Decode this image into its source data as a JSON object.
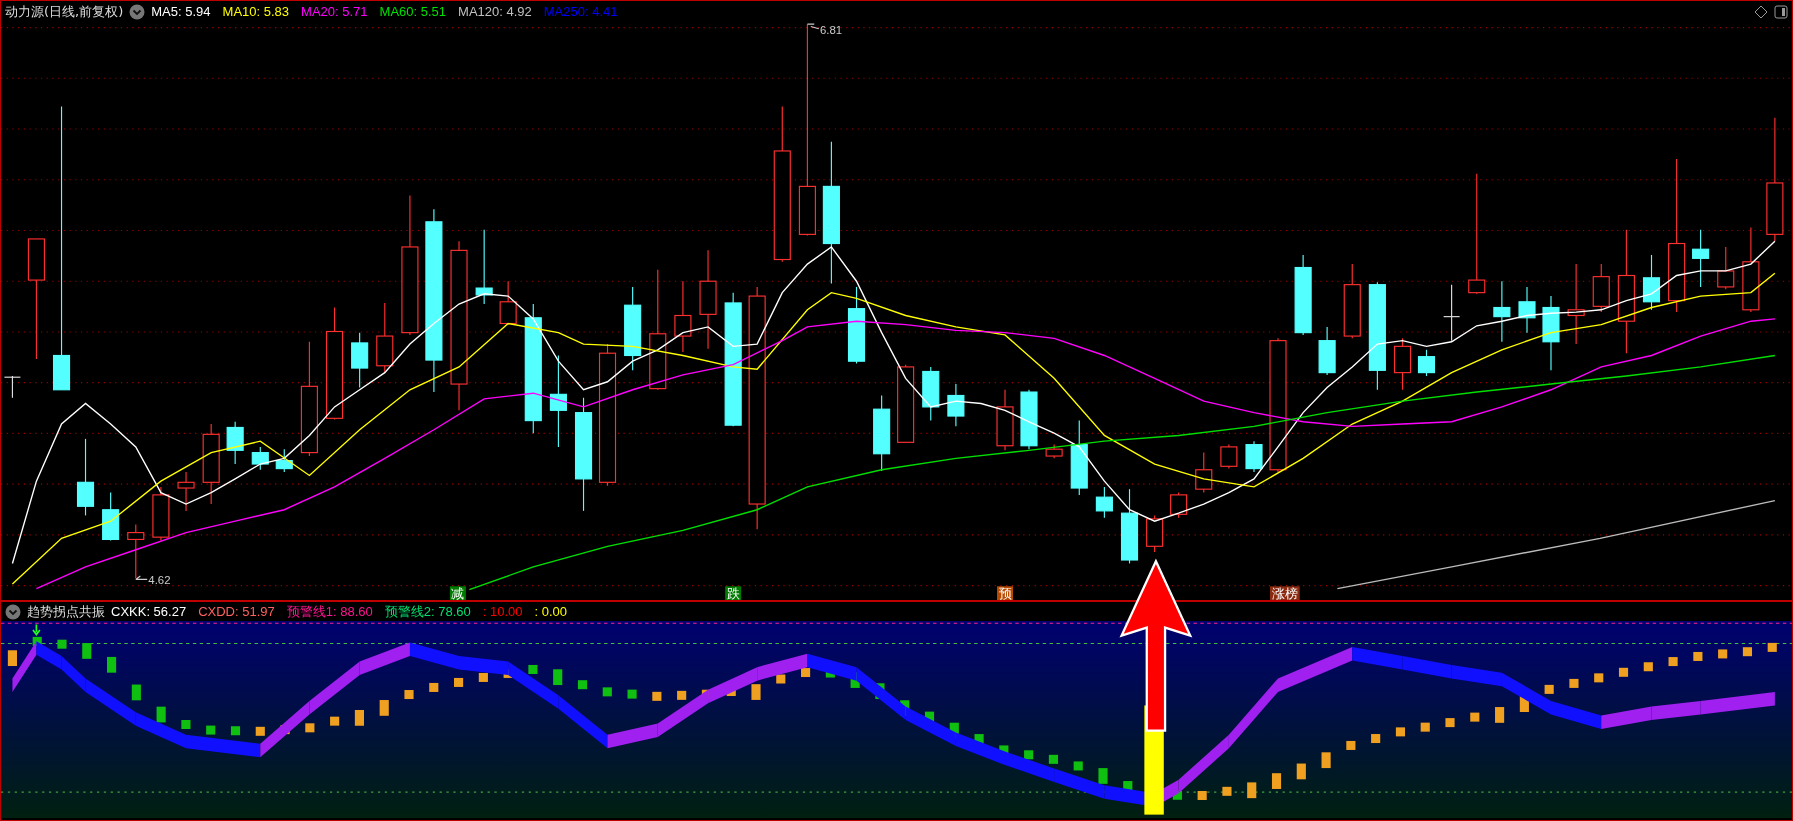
{
  "main_panel": {
    "title": "动力源(日线,前复权)",
    "indicators": [
      {
        "label": "MA5: 5.94",
        "color": "#ffffff"
      },
      {
        "label": "MA10: 5.83",
        "color": "#ffff00"
      },
      {
        "label": "MA20: 5.71",
        "color": "#ff00ff"
      },
      {
        "label": "MA60: 5.51",
        "color": "#00e000"
      },
      {
        "label": "MA120: 4.92",
        "color": "#c0c0c0"
      },
      {
        "label": "MA250: 4.41",
        "color": "#0000ff"
      }
    ],
    "high_label": "6.81",
    "low_label": "4.62",
    "signals": [
      {
        "text": "减",
        "color": "#007a00"
      },
      {
        "text": "跌",
        "color": "#007a00"
      },
      {
        "text": "预",
        "color": "#b84a00"
      },
      {
        "text": "涨榜",
        "color": "#8a2a10"
      }
    ]
  },
  "sub_panel": {
    "title": "趋势拐点共振",
    "indicators": [
      {
        "label": "CXKK: 56.27",
        "color": "#ffffff"
      },
      {
        "label": "CXDD: 51.97",
        "color": "#ff6060"
      },
      {
        "label": "预警线1: 88.60",
        "color": "#ff1493"
      },
      {
        "label": "预警线2: 78.60",
        "color": "#00e070"
      },
      {
        "label": ": 10.00",
        "color": "#ff0000"
      },
      {
        "label": ": 0.00",
        "color": "#ffff00"
      }
    ]
  }
}
